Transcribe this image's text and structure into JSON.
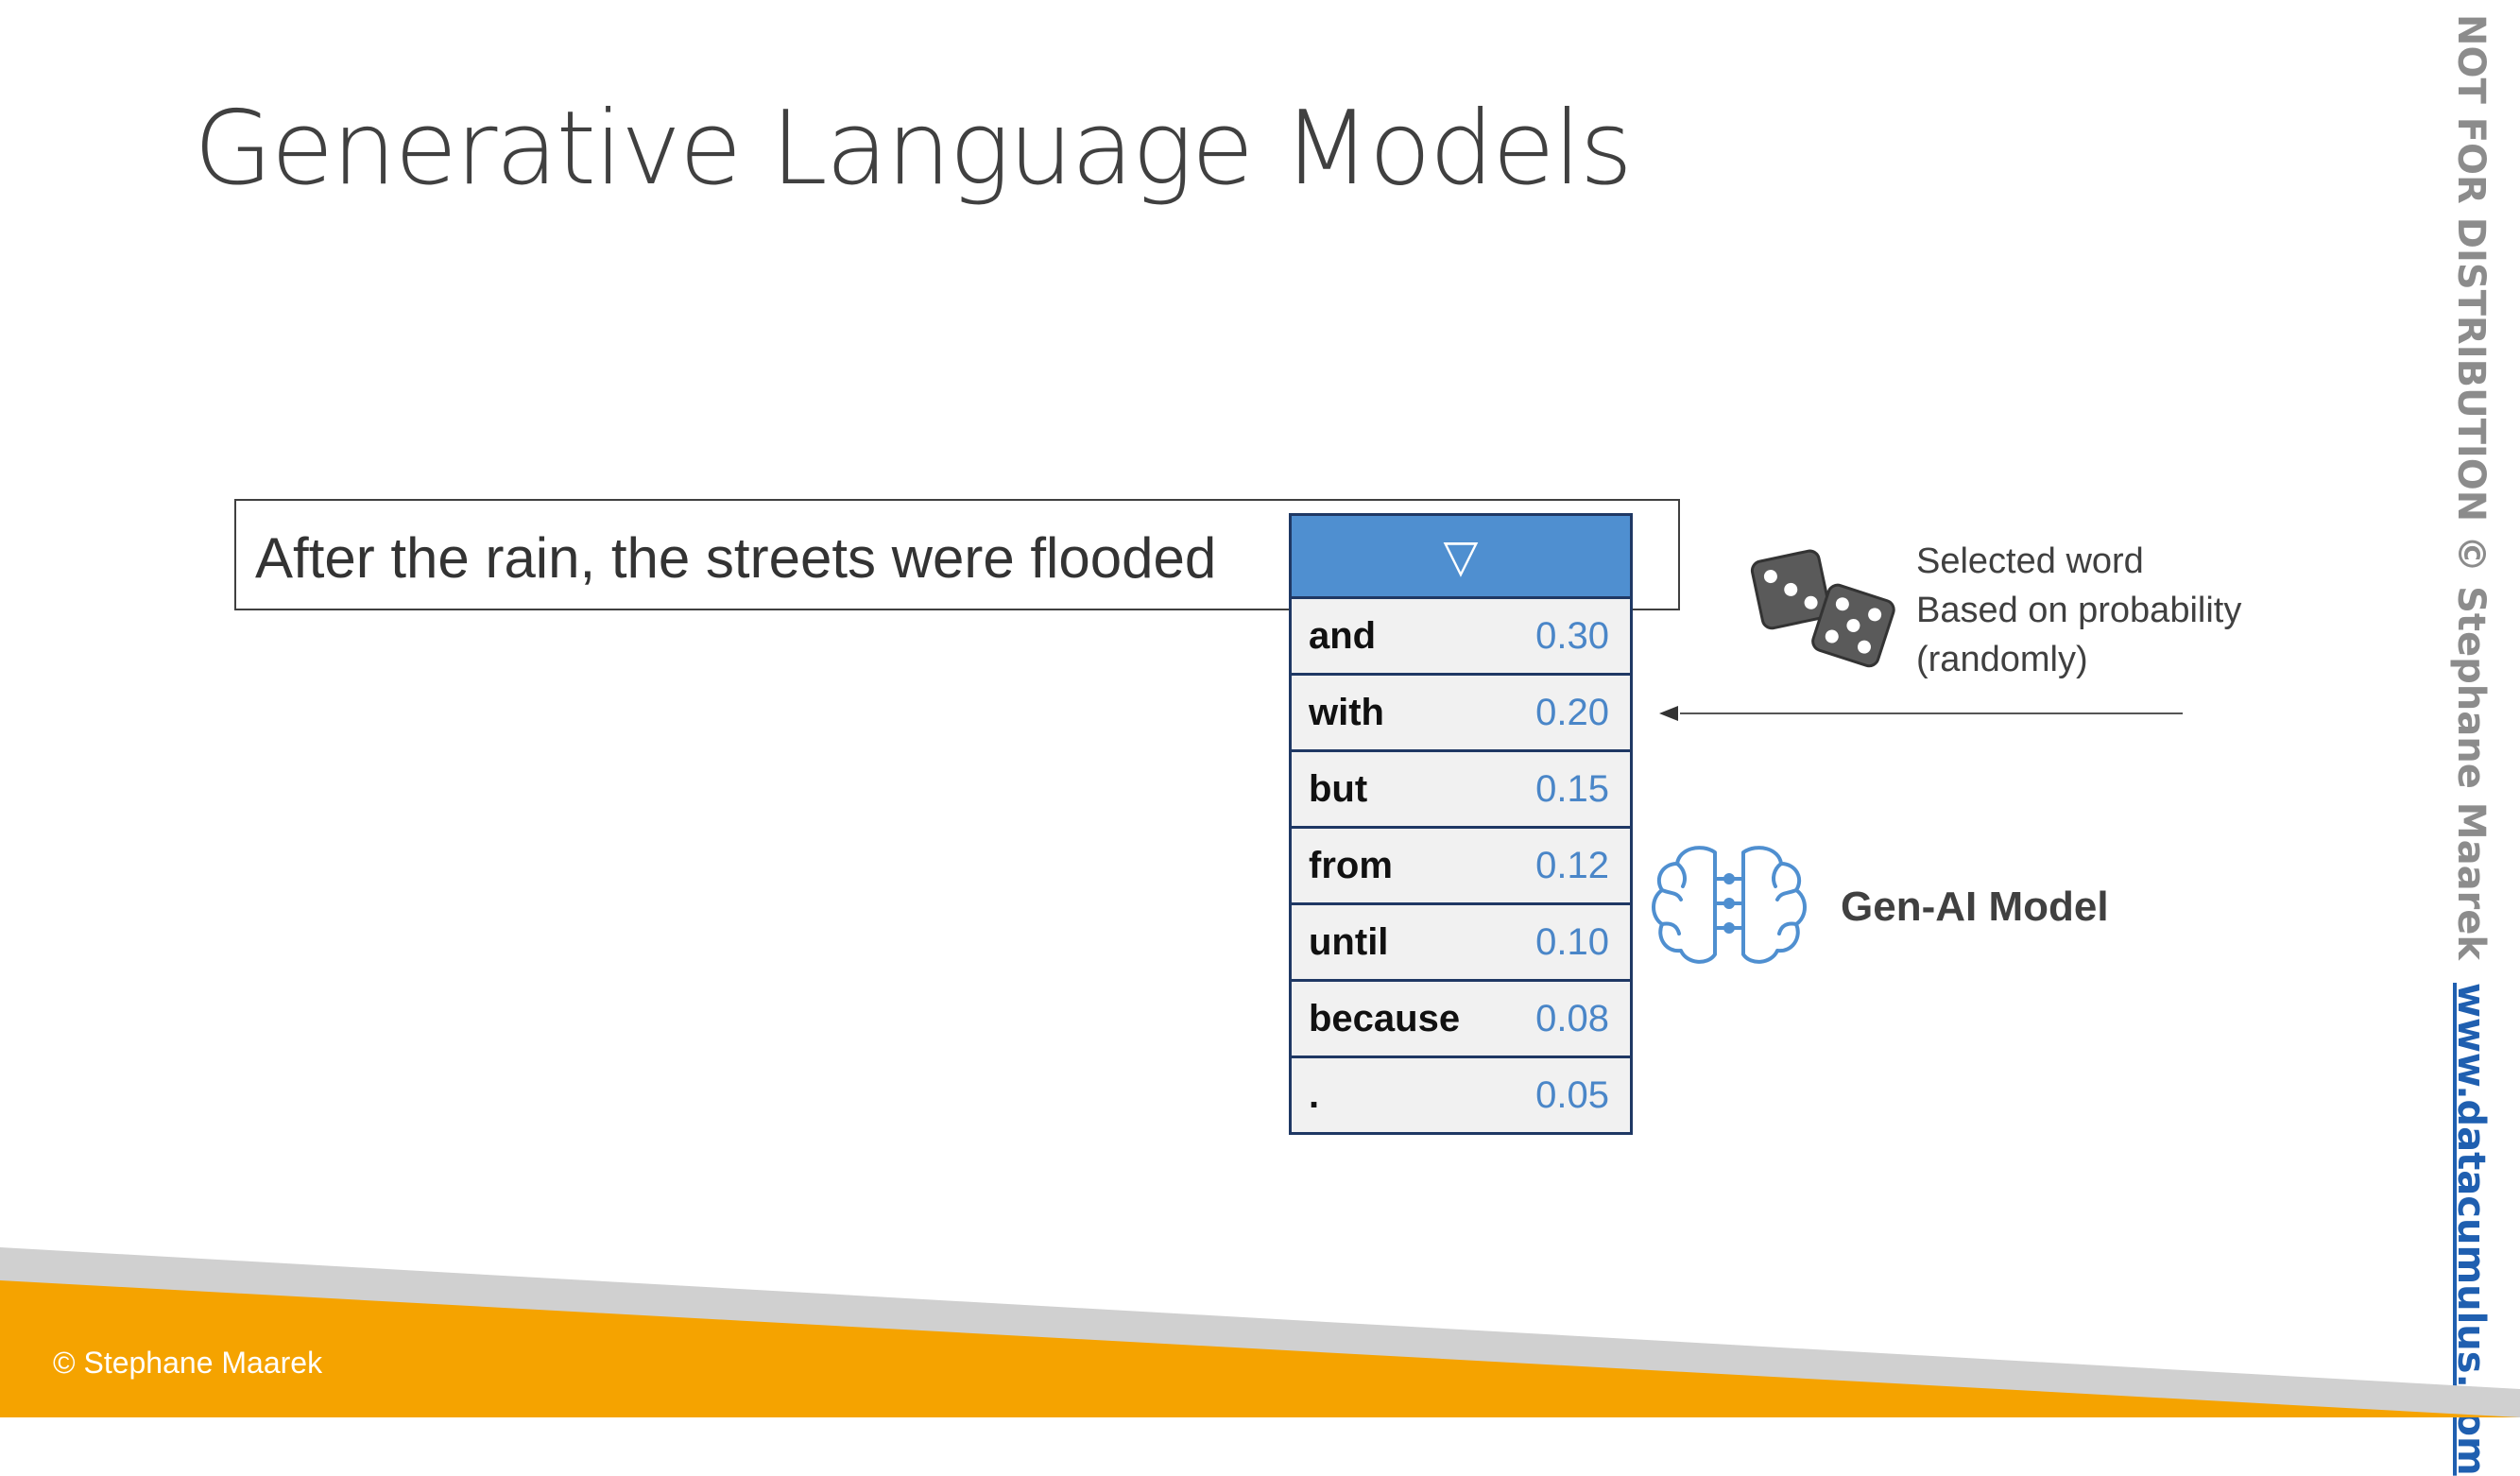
{
  "slide": {
    "title": "Generative Language Models",
    "sentence": "After the rain, the streets were flooded",
    "table": {
      "header_symbol": "▽",
      "rows": [
        {
          "word": "and",
          "prob": "0.30"
        },
        {
          "word": "with",
          "prob": "0.20"
        },
        {
          "word": "but",
          "prob": "0.15"
        },
        {
          "word": "from",
          "prob": "0.12"
        },
        {
          "word": "until",
          "prob": "0.10"
        },
        {
          "word": "because",
          "prob": "0.08"
        },
        {
          "word": ".",
          "prob": "0.05"
        }
      ]
    },
    "selected_note": {
      "line1": "Selected word",
      "line2": "Based on probability",
      "line3": "(randomly)"
    },
    "model_label": "Gen-AI Model",
    "icons": [
      "dice-icon",
      "brain-circuit-icon",
      "arrow-left-icon"
    ]
  },
  "watermark": {
    "text": "NOT FOR DISTRIBUTION © Stephane Maarek",
    "link": "www.datacumulus.com"
  },
  "footer": {
    "copyright": "© Stephane Maarek"
  },
  "colors": {
    "accent_blue": "#4f8fd0",
    "table_border": "#1f3864",
    "footer_orange": "#f5a300",
    "footer_gray": "#d0d0d0",
    "prob_text": "#4a86c8"
  }
}
